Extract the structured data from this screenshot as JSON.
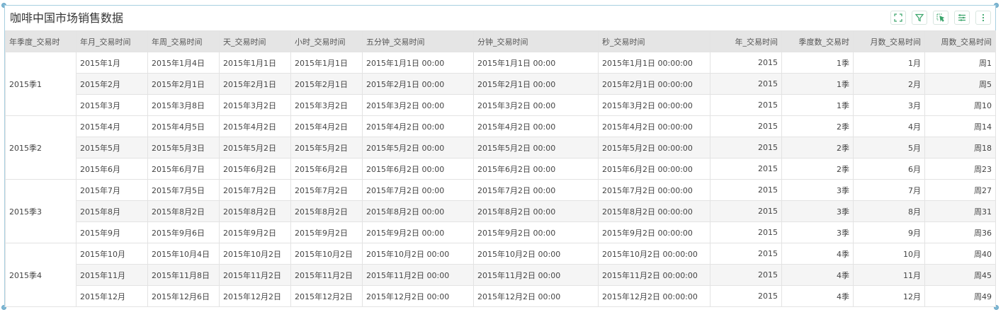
{
  "title": "咖啡中国市场销售数据",
  "toolbar": {
    "icons": [
      "fullscreen-icon",
      "filter-icon",
      "select-icon",
      "list-icon",
      "more-icon"
    ]
  },
  "colors": {
    "accent": "#3aa56b",
    "header_bg": "#e5e5e5",
    "stripe": "#f5f5f5",
    "frame": "#a8cfe0"
  },
  "table": {
    "columns": [
      "年季度_交易时",
      "年月_交易时间",
      "年周_交易时间",
      "天_交易时间",
      "小时_交易时间",
      "五分钟_交易时间",
      "分钟_交易时间",
      "秒_交易时间",
      "年_交易时间",
      "季度数_交易时",
      "月数_交易时间",
      "周数_交易时间"
    ],
    "groups": [
      {
        "label": "2015季1",
        "rows": [
          [
            "2015年1月",
            "2015年1月4日",
            "2015年1月1日",
            "2015年1月1日",
            "2015年1月1日 00:00",
            "2015年1月1日 00:00",
            "2015年1月1日 00:00:00",
            "2015",
            "1季",
            "1月",
            "周1"
          ],
          [
            "2015年2月",
            "2015年2月1日",
            "2015年2月1日",
            "2015年2月1日",
            "2015年2月1日 00:00",
            "2015年2月1日 00:00",
            "2015年2月1日 00:00:00",
            "2015",
            "1季",
            "2月",
            "周5"
          ],
          [
            "2015年3月",
            "2015年3月8日",
            "2015年3月2日",
            "2015年3月2日",
            "2015年3月2日 00:00",
            "2015年3月2日 00:00",
            "2015年3月2日 00:00:00",
            "2015",
            "1季",
            "3月",
            "周10"
          ]
        ]
      },
      {
        "label": "2015季2",
        "rows": [
          [
            "2015年4月",
            "2015年4月5日",
            "2015年4月2日",
            "2015年4月2日",
            "2015年4月2日 00:00",
            "2015年4月2日 00:00",
            "2015年4月2日 00:00:00",
            "2015",
            "2季",
            "4月",
            "周14"
          ],
          [
            "2015年5月",
            "2015年5月3日",
            "2015年5月2日",
            "2015年5月2日",
            "2015年5月2日 00:00",
            "2015年5月2日 00:00",
            "2015年5月2日 00:00:00",
            "2015",
            "2季",
            "5月",
            "周18"
          ],
          [
            "2015年6月",
            "2015年6月7日",
            "2015年6月2日",
            "2015年6月2日",
            "2015年6月2日 00:00",
            "2015年6月2日 00:00",
            "2015年6月2日 00:00:00",
            "2015",
            "2季",
            "6月",
            "周23"
          ]
        ]
      },
      {
        "label": "2015季3",
        "rows": [
          [
            "2015年7月",
            "2015年7月5日",
            "2015年7月2日",
            "2015年7月2日",
            "2015年7月2日 00:00",
            "2015年7月2日 00:00",
            "2015年7月2日 00:00:00",
            "2015",
            "3季",
            "7月",
            "周27"
          ],
          [
            "2015年8月",
            "2015年8月2日",
            "2015年8月2日",
            "2015年8月2日",
            "2015年8月2日 00:00",
            "2015年8月2日 00:00",
            "2015年8月2日 00:00:00",
            "2015",
            "3季",
            "8月",
            "周31"
          ],
          [
            "2015年9月",
            "2015年9月6日",
            "2015年9月2日",
            "2015年9月2日",
            "2015年9月2日 00:00",
            "2015年9月2日 00:00",
            "2015年9月2日 00:00:00",
            "2015",
            "3季",
            "9月",
            "周36"
          ]
        ]
      },
      {
        "label": "2015季4",
        "rows": [
          [
            "2015年10月",
            "2015年10月4日",
            "2015年10月2日",
            "2015年10月2日",
            "2015年10月2日 00:00",
            "2015年10月2日 00:00",
            "2015年10月2日 00:00:00",
            "2015",
            "4季",
            "10月",
            "周40"
          ],
          [
            "2015年11月",
            "2015年11月8日",
            "2015年11月2日",
            "2015年11月2日",
            "2015年11月2日 00:00",
            "2015年11月2日 00:00",
            "2015年11月2日 00:00:00",
            "2015",
            "4季",
            "11月",
            "周45"
          ],
          [
            "2015年12月",
            "2015年12月6日",
            "2015年12月2日",
            "2015年12月2日",
            "2015年12月2日 00:00",
            "2015年12月2日 00:00",
            "2015年12月2日 00:00:00",
            "2015",
            "4季",
            "12月",
            "周49"
          ]
        ]
      }
    ]
  }
}
